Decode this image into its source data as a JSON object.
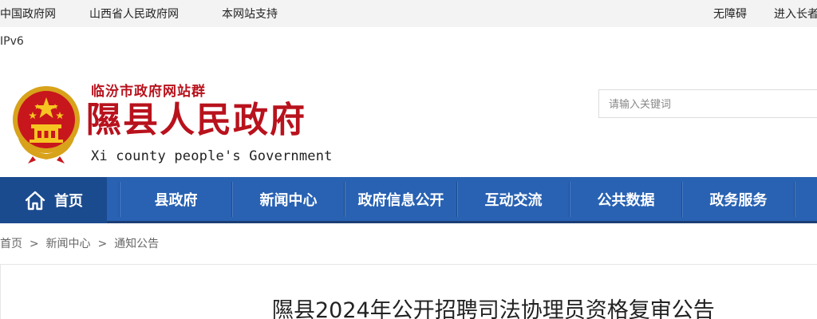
{
  "topbar": {
    "links_left": [
      "中国政府网",
      "山西省人民政府网",
      "本网站支持"
    ],
    "links_right": [
      "无障碍",
      "进入长者"
    ]
  },
  "ipv6_label": "IPv6",
  "header": {
    "site_group": "临汾市政府网站群",
    "title": "隰县人民政府",
    "subtitle": "Xi county people's Government"
  },
  "search": {
    "placeholder": "请输入关键词"
  },
  "nav": {
    "home": "首页",
    "items": [
      "县政府",
      "新闻中心",
      "政府信息公开",
      "互动交流",
      "公共数据",
      "政务服务"
    ]
  },
  "breadcrumb": {
    "items": [
      "首页",
      "新闻中心",
      "通知公告"
    ],
    "separator": ">"
  },
  "article": {
    "title": "隰县2024年公开招聘司法协理员资格复审公告"
  },
  "colors": {
    "brand_red": "#b8121d",
    "nav_blue": "#2962b3",
    "nav_dark": "#1b4b8f"
  }
}
